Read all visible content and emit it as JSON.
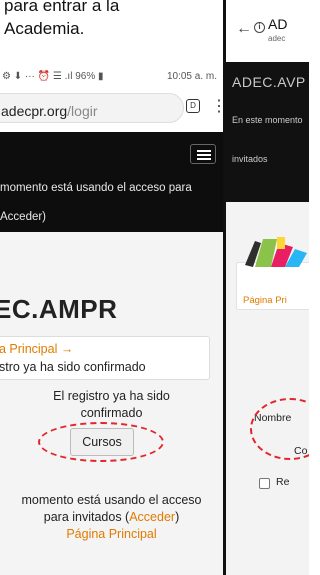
{
  "intro": {
    "line1": "para entrar a la",
    "line2": "Academia."
  },
  "left_phone": {
    "status_icons": "⚙ ⬇ ··· ⏰ ☰ .ıl 96% ▮",
    "status_time": "10:05 a. m.",
    "url_host": "adecpr.org",
    "url_path": "/logir",
    "tabs_label": "D",
    "notice_line1": "momento está usando el acceso para",
    "notice_line2": "Acceder)",
    "site_title": "EC.AMPR",
    "breadcrumb_link": "a Principal",
    "breadcrumb_sep": "→",
    "breadcrumb_text": "stro ya ha sido confirmado",
    "message_line1": "El registro ya ha sido",
    "message_line2": "confirmado",
    "cursos_button": "Cursos",
    "bottom_line1": "momento está usando el acceso",
    "bottom_line2_a": "para invitados (",
    "bottom_line2_link": "Acceder",
    "bottom_line2_b": ")",
    "bottom_line3": "Página Principal"
  },
  "right_phone": {
    "site_name": "AD",
    "site_sub": "adec",
    "brand": "ADEC.AVP",
    "msg1": "En este momento",
    "msg2": "invitados",
    "card_link": "Página Pri",
    "nombre": "Nombre",
    "co": "Co",
    "re": "Re"
  },
  "colors": {
    "accent_link": "#e07b00",
    "annotation_red": "#e3262e",
    "dark_bar": "#0d0d0d"
  }
}
